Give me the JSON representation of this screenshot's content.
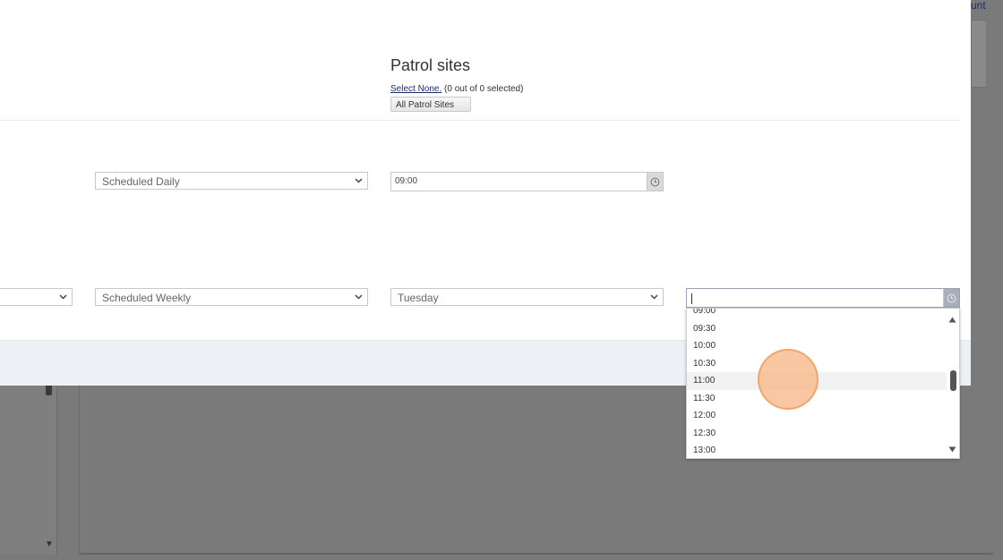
{
  "background": {
    "corner_link": "unt"
  },
  "patrol": {
    "title": "Patrol sites",
    "select_none": "Select None.",
    "selected_count": "(0 out of 0 selected)",
    "all_sites_button": "All Patrol Sites"
  },
  "row1": {
    "schedule_type": "Scheduled Daily",
    "time_value": "09:00"
  },
  "row2": {
    "first_select": "",
    "schedule_type": "Scheduled Weekly",
    "day": "Tuesday",
    "time_value": ""
  },
  "time_list": {
    "items": [
      "09:00",
      "09:30",
      "10:00",
      "10:30",
      "11:00",
      "11:30",
      "12:00",
      "12:30",
      "13:00"
    ],
    "hovered": "11:00"
  },
  "icons": {
    "clock": "clock-icon",
    "chevron": "chevron-down-icon"
  },
  "colors": {
    "overlay": "#7a7a7a",
    "link": "#1b2c6e",
    "footer": "#edf1f6",
    "click_marker": "#f7b482"
  }
}
